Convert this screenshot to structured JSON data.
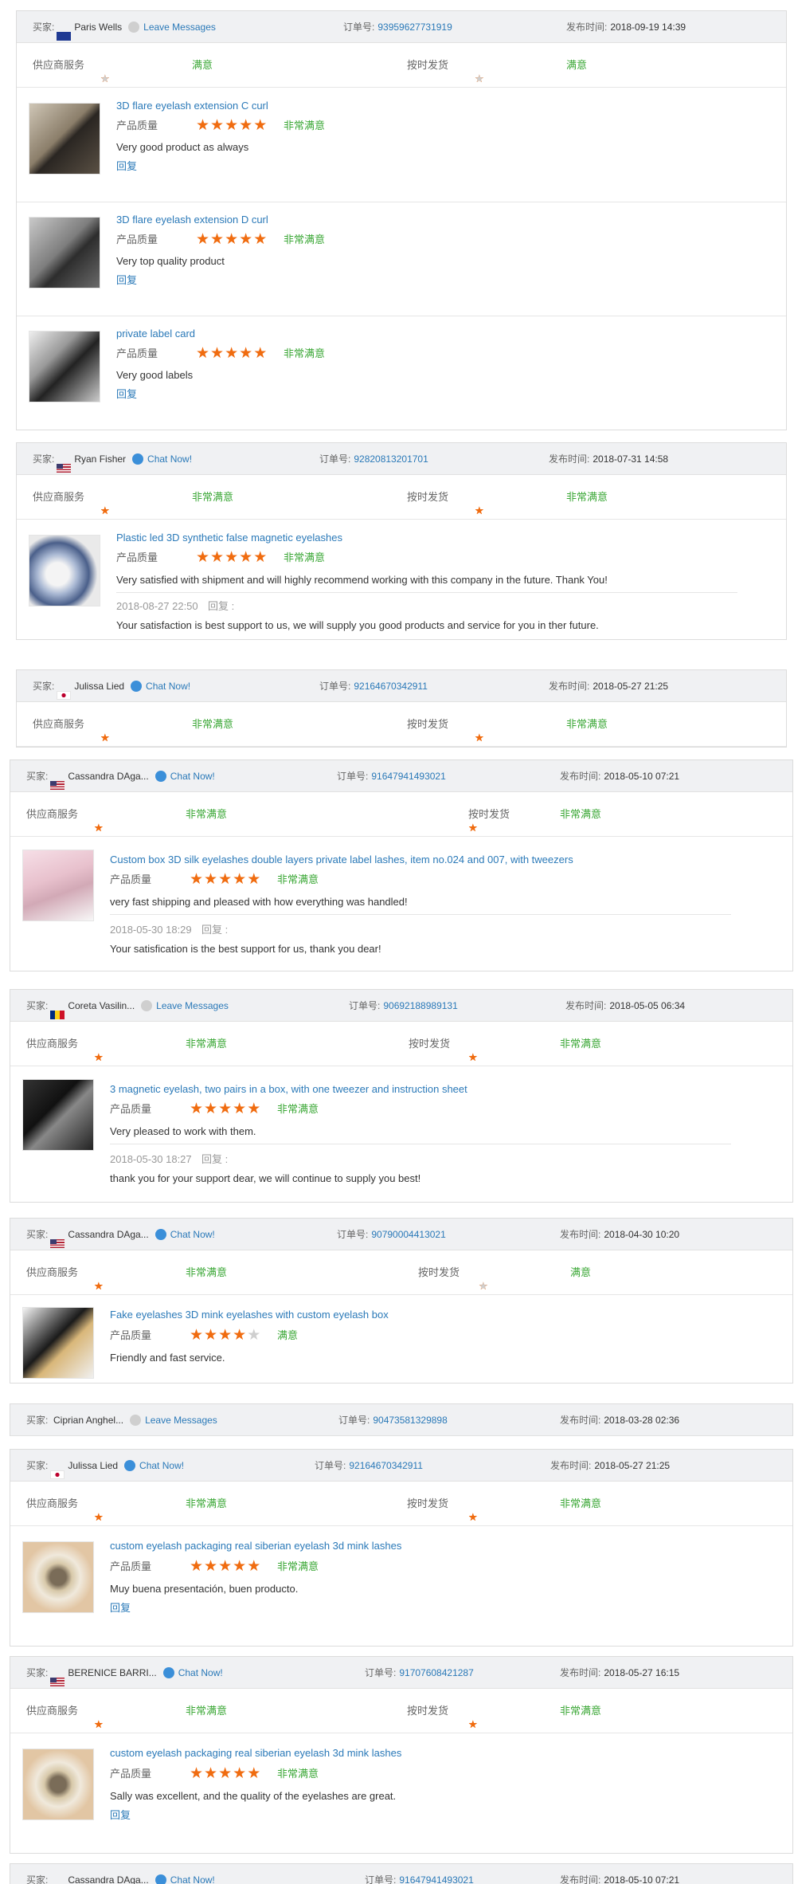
{
  "labels": {
    "buyer": "买家:",
    "order": "订单号:",
    "published": "发布时间:",
    "supplier_service": "供应商服务",
    "on_time": "按时发货",
    "quality": "产品质量",
    "reply": "回复",
    "reply_colon": "回复 :"
  },
  "colors": {
    "star_on": "#f06c10",
    "star_off": "#cfcfcf",
    "rating_text": "#3aa735",
    "link": "#2a79b8",
    "header_bg": "#f0f1f3"
  },
  "reviews": [
    {
      "buyer": "Paris Wells",
      "flag": "uk-flag-icon",
      "contact": "Leave Messages",
      "contact_icon": "offline-dot-icon",
      "order": "93959627731919",
      "time": "2018-09-19 14:39",
      "supplier_rating": 4,
      "supplier_text": "满意",
      "shipping_rating": 4,
      "shipping_text": "满意",
      "items": [
        {
          "title": "3D flare eyelash extension C curl",
          "rating": 5,
          "rating_text": "非常满意",
          "comment": "Very good product as always",
          "reply_link": "回复"
        },
        {
          "title": "3D flare eyelash extension D curl",
          "rating": 5,
          "rating_text": "非常满意",
          "comment": "Very top quality product",
          "reply_link": "回复"
        },
        {
          "title": "private label card",
          "rating": 5,
          "rating_text": "非常满意",
          "comment": "Very good labels",
          "reply_link": "回复"
        }
      ]
    },
    {
      "buyer": "Ryan Fisher",
      "flag": "us-flag-icon",
      "contact": "Chat Now!",
      "contact_icon": "chat-icon",
      "order": "92820813201701",
      "time": "2018-07-31 14:58",
      "supplier_rating": 5,
      "supplier_text": "非常满意",
      "shipping_rating": 5,
      "shipping_text": "非常满意",
      "items": [
        {
          "title": "Plastic led 3D synthetic false magnetic eyelashes",
          "rating": 5,
          "rating_text": "非常满意",
          "comment": "Very satisfied with shipment and will highly recommend working with this company in the future. Thank You!",
          "reply_time": "2018-08-27 22:50",
          "reply_text": "Your satisfaction is best support to us, we will supply you good products and service for you in ther future."
        }
      ]
    },
    {
      "buyer": "Julissa Lied",
      "flag": "jp-flag-icon",
      "contact": "Chat Now!",
      "contact_icon": "chat-icon",
      "order": "92164670342911",
      "time": "2018-05-27 21:25",
      "supplier_rating": 5,
      "supplier_text": "非常满意",
      "shipping_rating": 5,
      "shipping_text": "非常满意"
    },
    {
      "buyer": "Cassandra DAga...",
      "flag": "us-flag-icon",
      "contact": "Chat Now!",
      "contact_icon": "chat-icon",
      "order": "91647941493021",
      "time": "2018-05-10 07:21",
      "supplier_rating": 5,
      "supplier_text": "非常满意",
      "shipping_rating": 5,
      "shipping_text": "非常满意",
      "items": [
        {
          "title": "Custom box 3D silk eyelashes double layers private label lashes, item no.024 and 007, with tweezers",
          "rating": 5,
          "rating_text": "非常满意",
          "comment": "very fast shipping and pleased with how everything was handled!",
          "reply_time": "2018-05-30 18:29",
          "reply_text": "Your satisfication is the best support for us, thank you dear!"
        }
      ]
    },
    {
      "buyer": "Coreta Vasilin...",
      "flag": "ro-flag-icon",
      "contact": "Leave Messages",
      "contact_icon": "offline-dot-icon",
      "order": "90692188989131",
      "time": "2018-05-05 06:34",
      "supplier_rating": 5,
      "supplier_text": "非常满意",
      "shipping_rating": 5,
      "shipping_text": "非常满意",
      "items": [
        {
          "title": "3 magnetic eyelash, two pairs in a box, with one tweezer and instruction sheet",
          "rating": 5,
          "rating_text": "非常满意",
          "comment": "Very pleased to work with them.",
          "reply_time": "2018-05-30 18:27",
          "reply_text": "thank you for your support dear, we will continue to supply you best!"
        }
      ]
    },
    {
      "buyer": "Cassandra DAga...",
      "flag": "us-flag-icon",
      "contact": "Chat Now!",
      "contact_icon": "chat-icon",
      "order": "90790004413021",
      "time": "2018-04-30 10:20",
      "supplier_rating": 5,
      "supplier_text": "非常满意",
      "shipping_rating": 4,
      "shipping_text": "满意",
      "items": [
        {
          "title": "Fake eyelashes 3D mink eyelashes with custom eyelash box",
          "rating": 4,
          "rating_text": "满意",
          "comment": "Friendly and fast service."
        }
      ]
    },
    {
      "buyer": "Ciprian Anghel...",
      "flag": "",
      "contact": "Leave Messages",
      "contact_icon": "offline-dot-icon",
      "order": "90473581329898",
      "time": "2018-03-28 02:36"
    },
    {
      "buyer": "Julissa Lied",
      "flag": "jp-flag-icon",
      "contact": "Chat Now!",
      "contact_icon": "chat-icon",
      "order": "92164670342911",
      "time": "2018-05-27 21:25",
      "supplier_rating": 5,
      "supplier_text": "非常满意",
      "shipping_rating": 5,
      "shipping_text": "非常满意",
      "items": [
        {
          "title": "custom eyelash packaging real siberian eyelash 3d mink lashes",
          "rating": 5,
          "rating_text": "非常满意",
          "comment": "Muy buena presentación, buen producto.",
          "reply_link": "回复"
        }
      ]
    },
    {
      "buyer": "BERENICE BARRI...",
      "flag": "us-flag-icon",
      "contact": "Chat Now!",
      "contact_icon": "chat-icon",
      "order": "91707608421287",
      "time": "2018-05-27 16:15",
      "supplier_rating": 5,
      "supplier_text": "非常满意",
      "shipping_rating": 5,
      "shipping_text": "非常满意",
      "items": [
        {
          "title": "custom eyelash packaging real siberian eyelash 3d mink lashes",
          "rating": 5,
          "rating_text": "非常满意",
          "comment": "Sally was excellent, and the quality of the eyelashes are great.",
          "reply_link": "回复"
        }
      ]
    },
    {
      "buyer": "Cassandra DAga...",
      "flag": "us-flag-icon",
      "contact": "Chat Now!",
      "contact_icon": "chat-icon",
      "order": "91647941493021",
      "time": "2018-05-10 07:21"
    }
  ]
}
